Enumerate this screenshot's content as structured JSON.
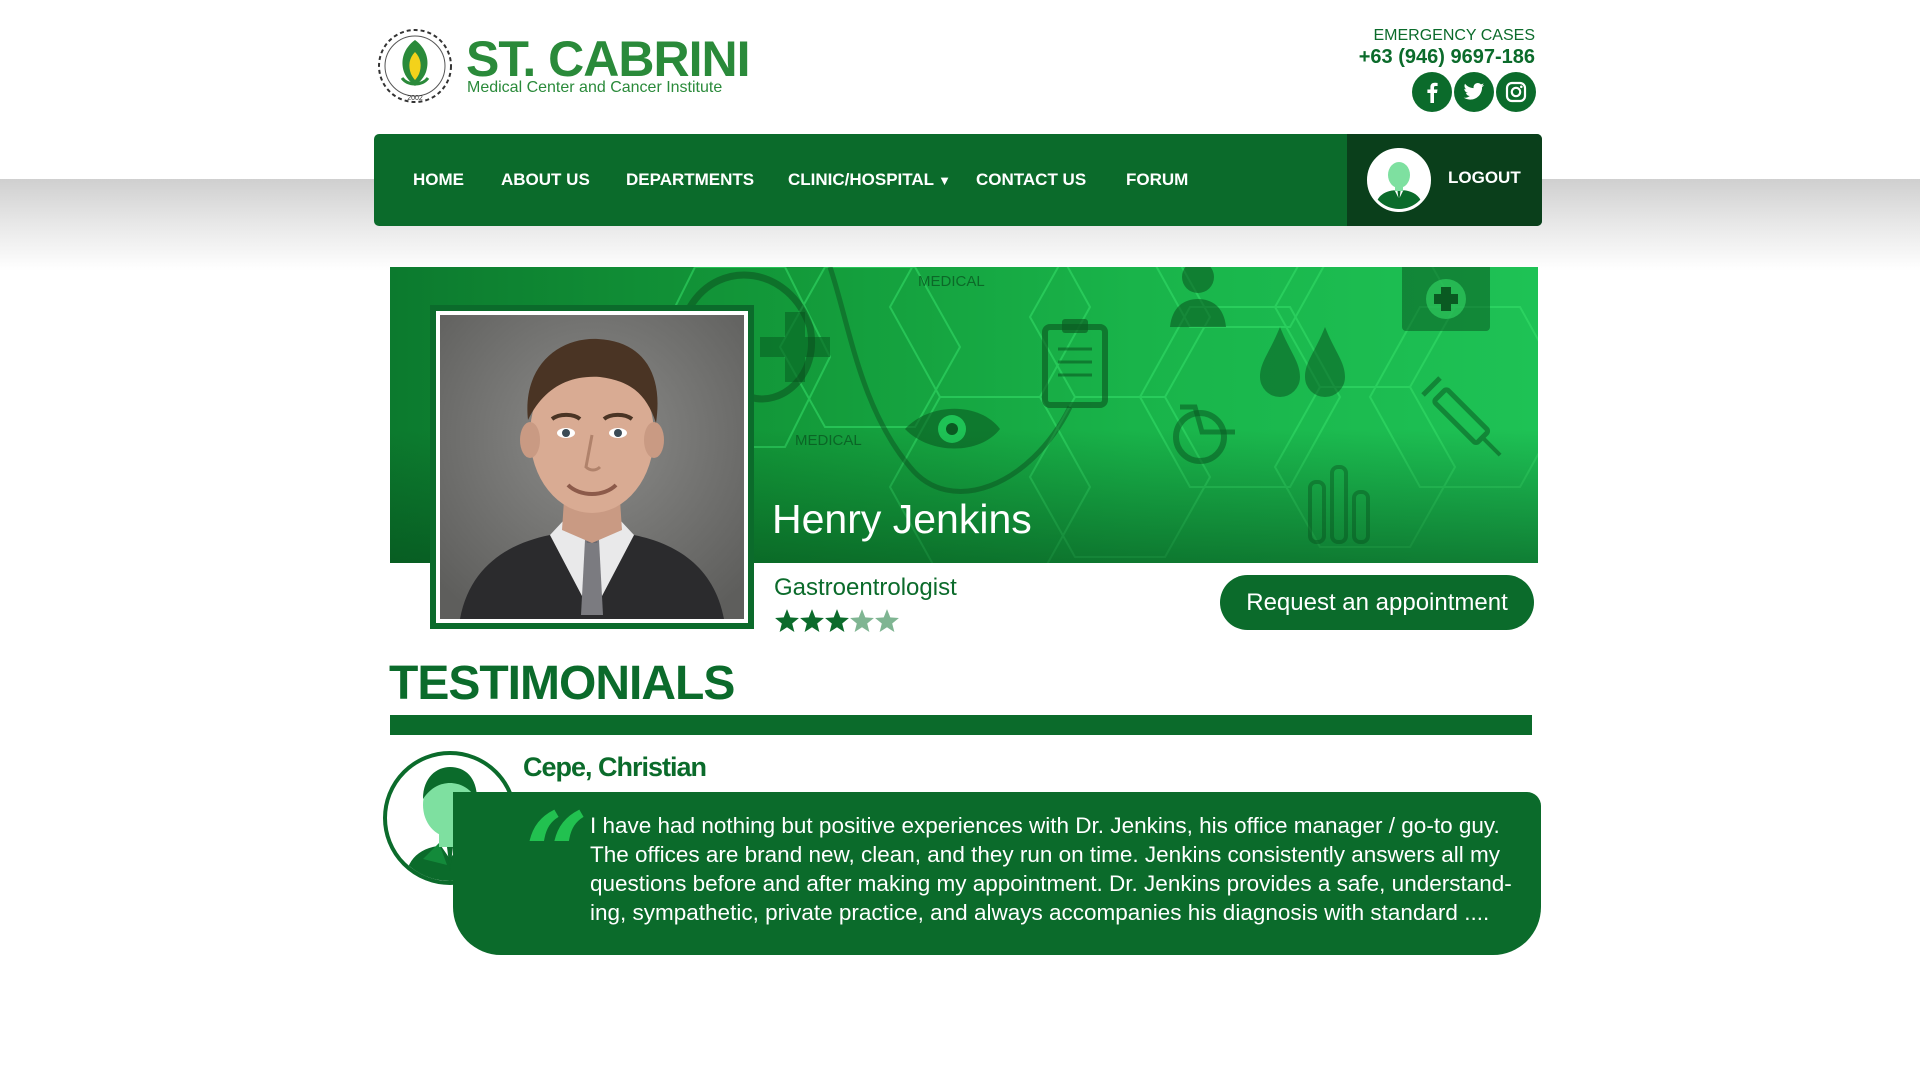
{
  "brand": {
    "name": "ST. CABRINI",
    "subtitle": "Medical Center and Cancer Institute",
    "logo_year": "2002",
    "color_primary": "#0b6b2b",
    "color_accent": "#22c150"
  },
  "header": {
    "emergency_label": "EMERGENCY CASES",
    "emergency_phone": "+63 (946) 9697-186",
    "social": [
      {
        "name": "facebook",
        "icon": "facebook-icon"
      },
      {
        "name": "twitter",
        "icon": "twitter-icon"
      },
      {
        "name": "instagram",
        "icon": "instagram-icon"
      }
    ]
  },
  "nav": {
    "items": [
      "HOME",
      "ABOUT US",
      "DEPARTMENTS",
      "CLINIC/HOSPITAL",
      "CONTACT US",
      "FORUM"
    ],
    "dropdown_caret": "▼",
    "logout_label": "LOGOUT"
  },
  "profile": {
    "banner_texts": [
      "MEDICAL",
      "MEDICAL"
    ],
    "name": "Henry Jenkins",
    "specialty": "Gastroentrologist",
    "rating": 3,
    "rating_max": 5,
    "appointment_label": "Request an appointment"
  },
  "testimonials": {
    "heading": "TESTIMONIALS",
    "items": [
      {
        "author": "Cepe, Christian",
        "quote_glyph": "“",
        "lines": [
          "I have had nothing but positive experiences with Dr. Jenkins, his office manager / go-to guy.",
          "The offices are brand new, clean, and they run on time.  Jenkins consistently answers all my",
          "questions before and after making my appointment.  Dr. Jenkins provides a safe, understand-",
          "ing, sympathetic, private practice, and always accompanies his diagnosis with standard ...."
        ]
      }
    ]
  }
}
